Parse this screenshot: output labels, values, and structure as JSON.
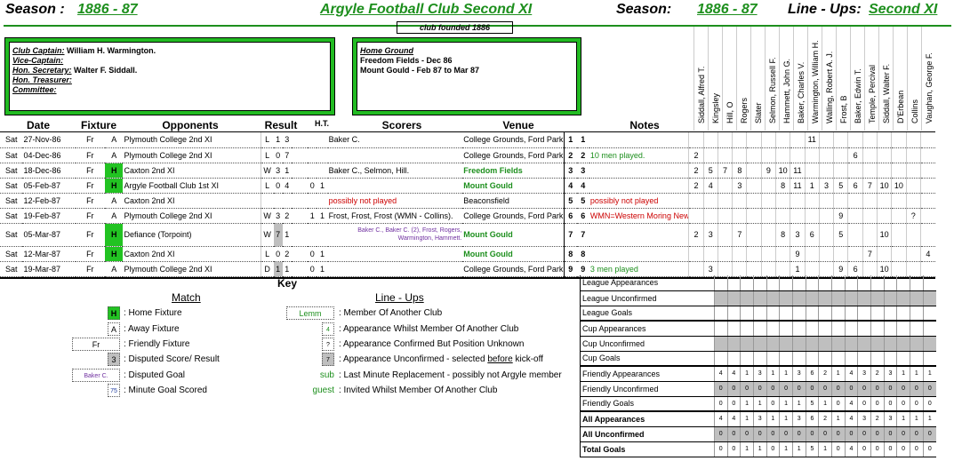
{
  "header": {
    "season_label": "Season :",
    "season_value": "1886 - 87",
    "title": "Argyle Football Club Second XI",
    "season_label2": "Season:",
    "season_value2": "1886 - 87",
    "lineups_label": "Line - Ups:",
    "lineups_value": "Second XI",
    "founded": "club founded 1886"
  },
  "officials": {
    "captain_l": "Club Captain:",
    "captain": "William H. Warmington.",
    "vice_l": "Vice-Captain:",
    "vice": "",
    "sec_l": "Hon. Secretary:",
    "sec": "Walter F. Siddall.",
    "treas_l": "Hon. Treasurer:",
    "comm_l": "Committee:"
  },
  "ground": {
    "label": "Home Ground",
    "line1": "Freedom Fields - Dec 86",
    "line2": "Mount Gould - Feb 87 to Mar 87"
  },
  "columns": {
    "date": "Date",
    "fixture": "Fixture",
    "opponents": "Opponents",
    "result": "Result",
    "ht": "H.T.",
    "scorers": "Scorers",
    "venue": "Venue",
    "notes": "Notes"
  },
  "players": [
    "Siddall, Alfred T.",
    "Kingsley",
    "Hill, O",
    "Rogers",
    "Slater",
    "Selmon, Russell F.",
    "Hammett, John G.",
    "Baker, Charles V.",
    "Warmington, William H.",
    "Walling, Robert A. J.",
    "Frost, B",
    "Baker, Edwin T.",
    "Temple, Percival",
    "Siddall, Walter F.",
    "D'Erbean",
    "Collins",
    "Vaughan, George F."
  ],
  "fixtures": [
    {
      "day": "Sat",
      "date": "27-Nov-86",
      "fix": "Fr",
      "ha": "A",
      "opp": "Plymouth College 2nd XI",
      "res": "L",
      "f": "1",
      "a": "3",
      "ht1": "",
      "ht2": "",
      "scorers": "Baker C.",
      "venue": "College Grounds, Ford Park",
      "n1": "1",
      "n2": "1",
      "note": "",
      "apps": [
        "",
        "",
        "",
        "",
        "",
        "",
        "",
        "",
        "11",
        "",
        "",
        "",
        "",
        "",
        "",
        "",
        ""
      ],
      "extra": {
        "4": "?"
      }
    },
    {
      "day": "Sat",
      "date": "04-Dec-86",
      "fix": "Fr",
      "ha": "A",
      "opp": "Plymouth College 2nd XI",
      "res": "L",
      "f": "0",
      "a": "7",
      "ht1": "",
      "ht2": "",
      "scorers": "",
      "venue": "College Grounds, Ford Park",
      "n1": "2",
      "n2": "2",
      "note": "10 men played.",
      "apps": [
        "2",
        "",
        "",
        "",
        "",
        "",
        "",
        "",
        "",
        "",
        "",
        "6",
        "",
        "",
        "",
        "",
        ""
      ]
    },
    {
      "day": "Sat",
      "date": "18-Dec-86",
      "fix": "Fr",
      "ha": "H",
      "opp": "Caxton 2nd XI",
      "res": "W",
      "f": "3",
      "a": "1",
      "ht1": "",
      "ht2": "",
      "scorers": "Baker C., Selmon, Hill.",
      "venue": "Freedom Fields",
      "n1": "3",
      "n2": "3",
      "note": "",
      "apps": [
        "2",
        "5",
        "7",
        "8",
        "",
        "9",
        "10",
        "11",
        "",
        "",
        "",
        "",
        "",
        "",
        "",
        "",
        ""
      ]
    },
    {
      "day": "Sat",
      "date": "05-Feb-87",
      "fix": "Fr",
      "ha": "H",
      "opp": "Argyle Football Club 1st XI",
      "res": "L",
      "f": "0",
      "a": "4",
      "ht1": "0",
      "ht2": "1",
      "scorers": "",
      "venue": "Mount Gould",
      "n1": "4",
      "n2": "4",
      "note": "",
      "apps": [
        "2",
        "4",
        "",
        "3",
        "",
        "",
        "8",
        "11",
        "1",
        "3",
        "5",
        "6",
        "7",
        "10",
        "10",
        "",
        ""
      ]
    },
    {
      "day": "Sat",
      "date": "12-Feb-87",
      "fix": "Fr",
      "ha": "A",
      "opp": "Caxton 2nd XI",
      "res": "",
      "f": "",
      "a": "",
      "ht1": "",
      "ht2": "",
      "scorers": "possibly not played",
      "venue": "Beaconsfield",
      "n1": "5",
      "n2": "5",
      "note": "possibly not played",
      "apps": [
        "",
        "",
        "",
        "",
        "",
        "",
        "",
        "",
        "",
        "",
        "",
        "",
        "",
        "",
        "",
        "",
        ""
      ]
    },
    {
      "day": "Sat",
      "date": "19-Feb-87",
      "fix": "Fr",
      "ha": "A",
      "opp": "Plymouth College 2nd XI",
      "res": "W",
      "f": "3",
      "a": "2",
      "ht1": "1",
      "ht2": "1",
      "scorers": "Frost, Frost, Frost (WMN - Collins).",
      "venue": "College Grounds, Ford Park",
      "n1": "6",
      "n2": "6",
      "note": "WMN=Western Moring News",
      "apps": [
        "",
        "",
        "",
        "",
        "",
        "",
        "",
        "",
        "",
        "",
        "9",
        "",
        "",
        "",
        "",
        "?",
        ""
      ]
    },
    {
      "day": "Sat",
      "date": "05-Mar-87",
      "fix": "Fr",
      "ha": "H",
      "opp": "Defiance (Torpoint)",
      "res": "W",
      "f": "7",
      "a": "1",
      "ht1": "",
      "ht2": "",
      "scorers": "Baker C., Baker C. (2), Frost, Rogers, Warmington, Hammett.",
      "venue": "Mount Gould",
      "n1": "7",
      "n2": "7",
      "note": "",
      "apps": [
        "2",
        "3",
        "",
        "7",
        "",
        "",
        "8",
        "3",
        "6",
        "",
        "5",
        "",
        "",
        "10",
        "",
        "",
        ""
      ]
    },
    {
      "day": "Sat",
      "date": "12-Mar-87",
      "fix": "Fr",
      "ha": "H",
      "opp": "Caxton 2nd XI",
      "res": "L",
      "f": "0",
      "a": "2",
      "ht1": "0",
      "ht2": "1",
      "scorers": "",
      "venue": "Mount Gould",
      "n1": "8",
      "n2": "8",
      "note": "",
      "apps": [
        "",
        "",
        "",
        "",
        "",
        "",
        "",
        "9",
        "",
        "",
        "",
        "",
        "7",
        "",
        "",
        "",
        "4"
      ]
    },
    {
      "day": "Sat",
      "date": "19-Mar-87",
      "fix": "Fr",
      "ha": "A",
      "opp": "Plymouth College 2nd XI",
      "res": "D",
      "f": "1",
      "a": "1",
      "ht1": "0",
      "ht2": "1",
      "scorers": "",
      "venue": "College Grounds, Ford Park",
      "n1": "9",
      "n2": "9",
      "note": "3 men played",
      "apps": [
        "",
        "3",
        "",
        "",
        "",
        "",
        "",
        "1",
        "",
        "",
        "9",
        "6",
        "",
        "10",
        "",
        "",
        ""
      ]
    }
  ],
  "key": {
    "title": "Key",
    "match": "Match",
    "lineups": "Line - Ups",
    "home_sym": "H",
    "home": ": Home Fixture",
    "away_sym": "A",
    "away": ": Away Fixture",
    "fr_sym": "Fr",
    "friendly": ": Friendly Fixture",
    "disp_sym": "3",
    "disputed": ": Disputed Score/ Result",
    "goal_sym": "Baker C.",
    "dgoal": ": Disputed Goal",
    "min_sym": "75",
    "minute": ": Minute Goal Scored",
    "lemm_sym": "Lemm",
    "member": ": Member Of Another Club",
    "four_sym": "4",
    "whilst": ": Appearance Whilst Member Of Another Club",
    "q_sym": "?",
    "confirmed": ": Appearance Confirmed But Position Unknown",
    "seven_sym": "7",
    "unconf_a": ": Appearance Unconfirmed - selected",
    "unconf_b": "before",
    "unconf_c": "kick-off",
    "sub_sym": "sub",
    "sub": ": Last Minute Replacement - possibly not Argyle member",
    "guest_sym": "guest",
    "guest": ": Invited Whilst Member Of Another Club"
  },
  "stats": [
    {
      "label": "League Appearances",
      "shade": false,
      "vals": []
    },
    {
      "label": "League Unconfirmed",
      "shade": true,
      "vals": []
    },
    {
      "label": "League Goals",
      "shade": false,
      "vals": []
    },
    {
      "label": "Cup Appearances",
      "shade": false,
      "vals": []
    },
    {
      "label": "Cup Unconfirmed",
      "shade": true,
      "vals": []
    },
    {
      "label": "Cup Goals",
      "shade": false,
      "vals": []
    },
    {
      "label": "Friendly Appearances",
      "shade": false,
      "vals": [
        "4",
        "4",
        "1",
        "3",
        "1",
        "1",
        "3",
        "6",
        "2",
        "1",
        "4",
        "3",
        "2",
        "3",
        "1",
        "1",
        "1"
      ]
    },
    {
      "label": "Friendly Unconfirmed",
      "shade": true,
      "vals": [
        "0",
        "0",
        "0",
        "0",
        "0",
        "0",
        "0",
        "0",
        "0",
        "0",
        "0",
        "0",
        "0",
        "0",
        "0",
        "0",
        "0"
      ]
    },
    {
      "label": "Friendly Goals",
      "shade": false,
      "vals": [
        "0",
        "0",
        "1",
        "1",
        "0",
        "1",
        "1",
        "5",
        "1",
        "0",
        "4",
        "0",
        "0",
        "0",
        "0",
        "0",
        "0"
      ]
    },
    {
      "label": "All Appearances",
      "shade": false,
      "bold": true,
      "vals": [
        "4",
        "4",
        "1",
        "3",
        "1",
        "1",
        "3",
        "6",
        "2",
        "1",
        "4",
        "3",
        "2",
        "3",
        "1",
        "1",
        "1"
      ]
    },
    {
      "label": "All Unconfirmed",
      "shade": true,
      "bold": true,
      "vals": [
        "0",
        "0",
        "0",
        "0",
        "0",
        "0",
        "0",
        "0",
        "0",
        "0",
        "0",
        "0",
        "0",
        "0",
        "0",
        "0",
        "0"
      ]
    },
    {
      "label": "Total Goals",
      "shade": false,
      "bold": true,
      "vals": [
        "0",
        "0",
        "1",
        "1",
        "0",
        "1",
        "1",
        "5",
        "1",
        "0",
        "4",
        "0",
        "0",
        "0",
        "0",
        "0",
        "0"
      ]
    }
  ]
}
